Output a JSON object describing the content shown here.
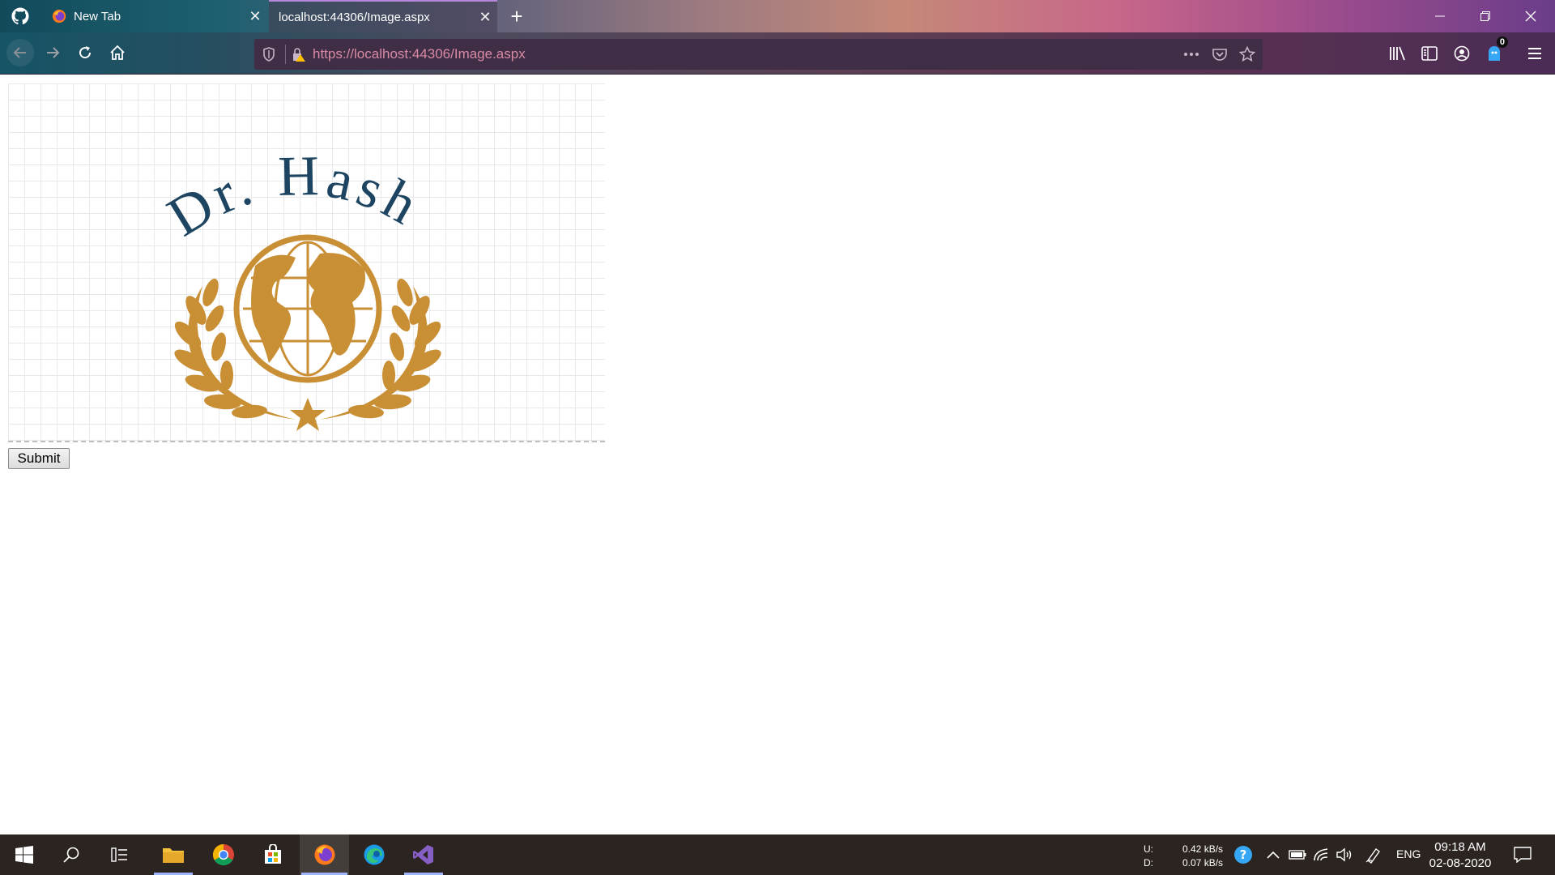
{
  "browser": {
    "tabs": [
      {
        "label": "New Tab",
        "active": false
      },
      {
        "label": "localhost:44306/Image.aspx",
        "active": true
      }
    ],
    "url": "https://localhost:44306/Image.aspx",
    "notification_badge": "0",
    "colors": {
      "accent_tab": "#b587d8",
      "url_text": "#d98aa5"
    }
  },
  "page": {
    "logo": {
      "title_text": "Dr. Hash",
      "title_color": "#1d4460",
      "emblem_color": "#c98f35"
    },
    "submit_label": "Submit"
  },
  "taskbar": {
    "network": {
      "upload_label": "U:",
      "upload_value": "0.42 kB/s",
      "download_label": "D:",
      "download_value": "0.07 kB/s"
    },
    "language": "ENG",
    "time": "09:18 AM",
    "date": "02-08-2020"
  }
}
